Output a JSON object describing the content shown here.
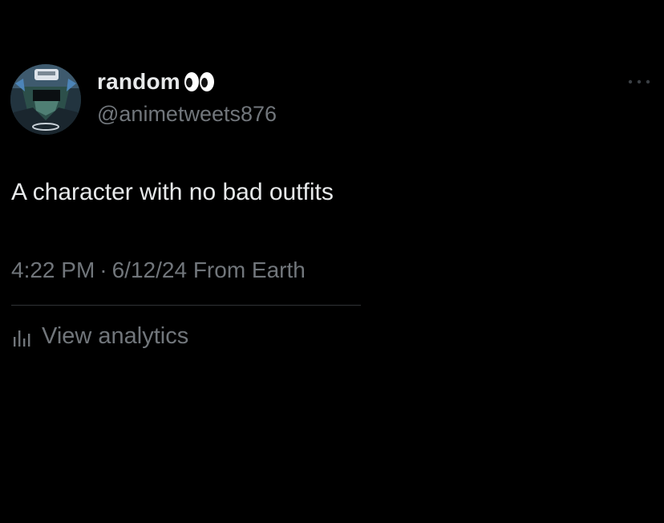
{
  "tweet": {
    "author": {
      "display_name": "random",
      "name_emoji_icon": "eyes-icon",
      "handle": "@animetweets876",
      "avatar_icon": "avatar-character-icon"
    },
    "text": "A character with no bad outfits",
    "time": "4:22 PM",
    "separator": "·",
    "date": "6/12/24",
    "source": "From Earth",
    "analytics_label": "View analytics",
    "analytics_icon": "bar-chart-icon",
    "more_icon": "more-options-icon"
  },
  "colors": {
    "background": "#000000",
    "primary_text": "#e7e9ea",
    "secondary_text": "#71767b",
    "divider": "#2f3336"
  }
}
